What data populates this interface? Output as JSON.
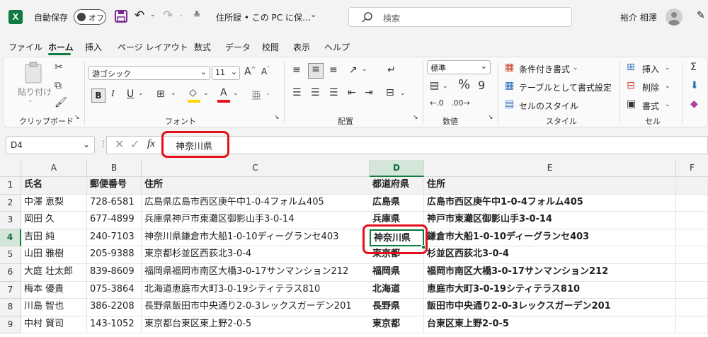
{
  "titlebar": {
    "app_icon": "excel-icon",
    "autosave_label": "自動保存",
    "autosave_state": "オフ",
    "filename": "住所録 • この PC に保…",
    "search_placeholder": "検索",
    "user_name": "裕介 相澤"
  },
  "menu": {
    "tabs": [
      "ファイル",
      "ホーム",
      "挿入",
      "ページ レイアウト",
      "数式",
      "データ",
      "校閲",
      "表示",
      "ヘルプ"
    ],
    "active": "ホーム"
  },
  "ribbon": {
    "clipboard": {
      "paste": "貼り付け",
      "label": "クリップボード"
    },
    "font": {
      "name": "游ゴシック",
      "size": "11",
      "bold": "B",
      "label": "フォント"
    },
    "alignment": {
      "label": "配置"
    },
    "number": {
      "format": "標準",
      "percent": "%",
      "comma": "9",
      "label": "数値"
    },
    "styles": {
      "conditional": "条件付き書式",
      "table": "テーブルとして書式設定",
      "cell": "セルのスタイル",
      "label": "スタイル"
    },
    "cells": {
      "insert": "挿入",
      "delete": "削除",
      "format": "書式",
      "label": "セル"
    }
  },
  "formula_bar": {
    "name_box": "D4",
    "fx": "fx",
    "content": "神奈川県"
  },
  "grid": {
    "columns": [
      "A",
      "B",
      "C",
      "D",
      "E",
      "F"
    ],
    "selected_column": "D",
    "selected_row": "4",
    "rows": [
      {
        "num": "1",
        "A": "氏名",
        "B": "郵便番号",
        "C": "住所",
        "D": "都道府県",
        "E": "住所"
      },
      {
        "num": "2",
        "A": "中澤 恵梨",
        "B": "728-6581",
        "C": "広島県広島市西区庚午中1-0-4フォルム405",
        "D": "広島県",
        "E": "広島市西区庚午中1-0-4フォルム405"
      },
      {
        "num": "3",
        "A": "岡田 久",
        "B": "677-4899",
        "C": "兵庫県神戸市東灘区御影山手3-0-14",
        "D": "兵庫県",
        "E": "神戸市東灘区御影山手3-0-14"
      },
      {
        "num": "4",
        "A": "吉田 純",
        "B": "240-7103",
        "C": "神奈川県鎌倉市大船1-0-10ディーグランセ403",
        "D": "神奈川県",
        "E": "鎌倉市大船1-0-10ディーグランセ403"
      },
      {
        "num": "5",
        "A": "山田 雅樹",
        "B": "205-9388",
        "C": "東京都杉並区西荻北3-0-4",
        "D": "東京都",
        "E": "杉並区西荻北3-0-4"
      },
      {
        "num": "6",
        "A": "大庭 壮太郎",
        "B": "839-8609",
        "C": "福岡県福岡市南区大橋3-0-17サンマンション212",
        "D": "福岡県",
        "E": "福岡市南区大橋3-0-17サンマンション212"
      },
      {
        "num": "7",
        "A": "梅本 優貴",
        "B": "075-3864",
        "C": "北海道恵庭市大町3-0-19シティテラス810",
        "D": "北海道",
        "E": "恵庭市大町3-0-19シティテラス810"
      },
      {
        "num": "8",
        "A": "川島 智也",
        "B": "386-2208",
        "C": "長野県飯田市中央通り2-0-3レックスガーデン201",
        "D": "長野県",
        "E": "飯田市中央通り2-0-3レックスガーデン201"
      },
      {
        "num": "9",
        "A": "中村 賢司",
        "B": "143-1052",
        "C": "東京都台東区東上野2-0-5",
        "D": "東京都",
        "E": "台東区東上野2-0-5"
      }
    ]
  },
  "colors": {
    "accent": "#107c41",
    "highlight": "#e4101b",
    "selected_header": "#d3e6d9"
  }
}
